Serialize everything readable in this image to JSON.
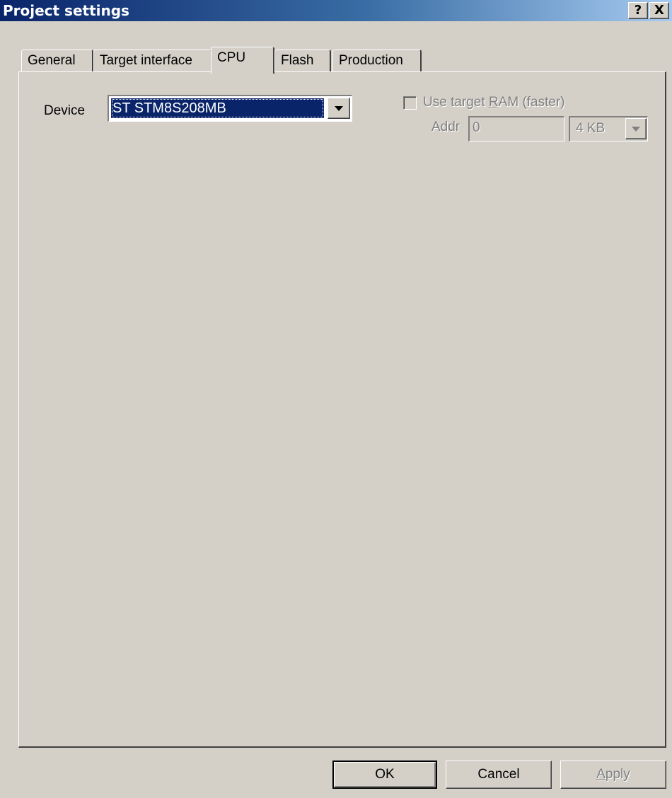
{
  "window": {
    "title": "Project settings",
    "help_label": "?",
    "close_label": "X"
  },
  "tabs": [
    {
      "label": "General",
      "active": false
    },
    {
      "label": "Target interface",
      "active": false
    },
    {
      "label": "CPU",
      "active": true
    },
    {
      "label": "Flash",
      "active": false
    },
    {
      "label": "Production",
      "active": false
    }
  ],
  "cpu": {
    "device_label": "Device",
    "device_value": "ST STM8S208MB",
    "use_target_ram_prefix": "Use target ",
    "use_target_ram_mnemonic": "R",
    "use_target_ram_suffix": "AM (faster)",
    "use_target_ram_checked": false,
    "use_target_ram_enabled": false,
    "addr_label": "Addr",
    "addr_value": "0",
    "size_value": "4 KB"
  },
  "buttons": {
    "ok": "OK",
    "cancel": "Cancel",
    "apply_mnemonic": "A",
    "apply_rest": "pply"
  },
  "colors": {
    "titlebar_start": "#0a246a",
    "titlebar_end": "#a6caf0",
    "face": "#d4d0c8",
    "selection": "#0a246a",
    "disabled_text": "#808080"
  }
}
